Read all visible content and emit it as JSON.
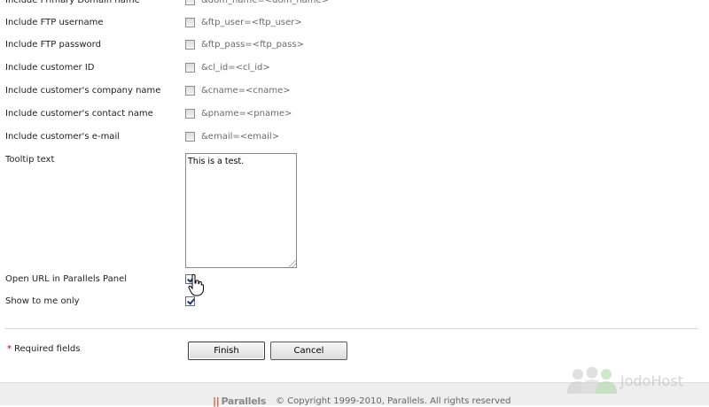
{
  "form": {
    "rows": [
      {
        "label": "Include Primary Domain name",
        "param": "&dom_name=<dom_name>",
        "checked": false
      },
      {
        "label": "Include FTP username",
        "param": "&ftp_user=<ftp_user>",
        "checked": false
      },
      {
        "label": "Include FTP password",
        "param": "&ftp_pass=<ftp_pass>",
        "checked": false
      },
      {
        "label": "Include customer ID",
        "param": "&cl_id=<cl_id>",
        "checked": false
      },
      {
        "label": "Include customer's company name",
        "param": "&cname=<cname>",
        "checked": false
      },
      {
        "label": "Include customer's contact name",
        "param": "&pname=<pname>",
        "checked": false
      },
      {
        "label": "Include customer's e-mail",
        "param": "&email=<email>",
        "checked": false
      }
    ],
    "tooltip": {
      "label": "Tooltip text",
      "value": "This is a test."
    },
    "open_in_panel": {
      "label": "Open URL in Parallels Panel",
      "checked": true
    },
    "show_to_me_only": {
      "label": "Show to me only",
      "checked": true
    }
  },
  "actions": {
    "required_star": "*",
    "required_text": "Required fields",
    "finish_label": "Finish",
    "cancel_label": "Cancel"
  },
  "footer": {
    "brand": "Parallels",
    "copyright": "© Copyright 1999-2010, Parallels. All rights reserved"
  },
  "watermark": {
    "text": "JodoHost"
  },
  "colors": {
    "required_star": "#c00000",
    "brand_bars": "#e14f2b",
    "checkmark": "#203a78"
  }
}
